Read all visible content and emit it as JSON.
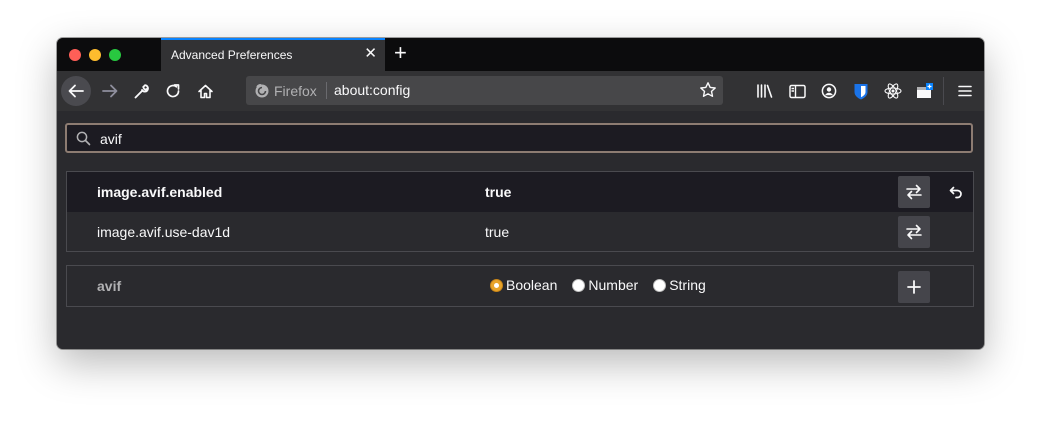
{
  "tab": {
    "title": "Advanced Preferences"
  },
  "urlbar": {
    "identity_label": "Firefox",
    "url": "about:config"
  },
  "search": {
    "value": "avif"
  },
  "prefs": [
    {
      "name": "image.avif.enabled",
      "value": "true",
      "modified": true
    },
    {
      "name": "image.avif.use-dav1d",
      "value": "true",
      "modified": false
    }
  ],
  "add_pref": {
    "name": "avif",
    "types": [
      {
        "label": "Boolean",
        "selected": true
      },
      {
        "label": "Number",
        "selected": false
      },
      {
        "label": "String",
        "selected": false
      }
    ]
  },
  "colors": {
    "accent_tab": "#0a84ff",
    "radio_selected": "#e8a42a",
    "search_border": "#8d7c72",
    "background": "#2a2a2e"
  },
  "icons": {
    "toolbar": [
      "library-icon",
      "sidebar-icon",
      "account-icon",
      "bitwarden-icon",
      "react-devtools-icon",
      "container-tab-icon",
      "menu-icon"
    ]
  }
}
